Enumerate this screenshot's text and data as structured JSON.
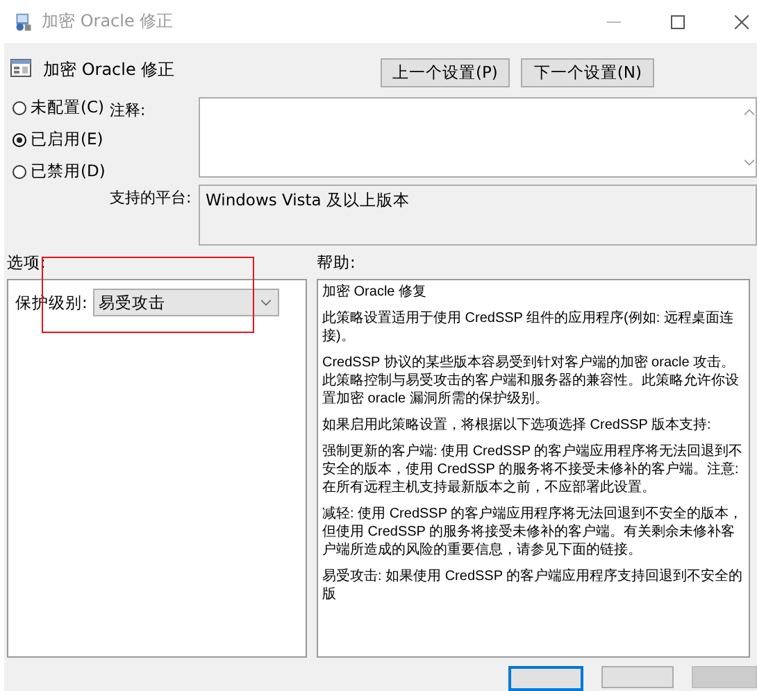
{
  "window": {
    "title": "加密 Oracle 修正"
  },
  "header": {
    "title": "加密 Oracle 修正",
    "buttons": [
      "上一个设置(P)",
      "下一个设置(N)"
    ]
  },
  "state_options": [
    {
      "label": "未配置(C)",
      "selected": false
    },
    {
      "label": "已启用(E)",
      "selected": true
    },
    {
      "label": "已禁用(D)",
      "selected": false
    }
  ],
  "comment": {
    "label": "注释:"
  },
  "platform": {
    "label": "支持的平台:",
    "value": "Windows Vista 及以上版本"
  },
  "options": {
    "label": "选项:",
    "field_label": "保护级别:",
    "value": "易受攻击"
  },
  "help": {
    "label": "帮助:",
    "paragraphs": [
      "加密 Oracle 修复",
      "此策略设置适用于使用 CredSSP 组件的应用程序(例如: 远程桌面连接)。",
      "CredSSP 协议的某些版本容易受到针对客户端的加密 oracle 攻击。此策略控制与易受攻击的客户端和服务器的兼容性。此策略允许你设置加密 oracle 漏洞所需的保护级别。",
      "如果启用此策略设置，将根据以下选项选择 CredSSP 版本支持:",
      "强制更新的客户端: 使用 CredSSP 的客户端应用程序将无法回退到不安全的版本，使用 CredSSP 的服务将不接受未修补的客户端。注意: 在所有远程主机支持最新版本之前，不应部署此设置。",
      "减轻: 使用 CredSSP 的客户端应用程序将无法回退到不安全的版本，但使用 CredSSP 的服务将接受未修补的客户端。有关剩余未修补客户端所造成的风险的重要信息，请参见下面的链接。",
      "易受攻击: 如果使用 CredSSP 的客户端应用程序支持回退到不安全的版"
    ]
  },
  "highlight": {
    "shown": true
  }
}
